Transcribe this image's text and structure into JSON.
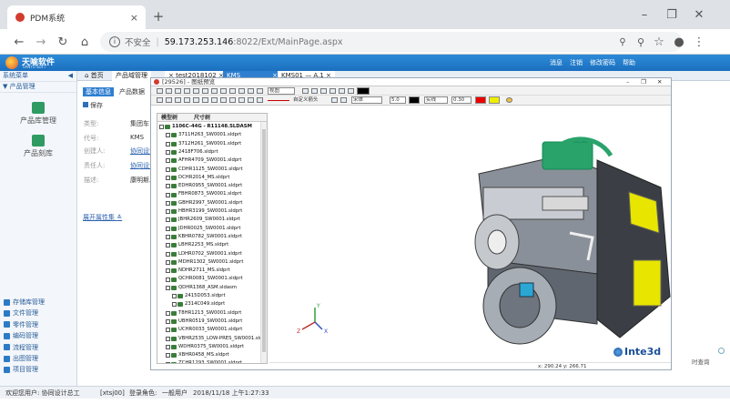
{
  "browser": {
    "tab_title": "PDM系统",
    "tab_close": "×",
    "new_tab": "+",
    "insecure_label": "不安全",
    "url_host": "59.173.253.146",
    "url_rest": ":8022/Ext/MainPage.aspx"
  },
  "app": {
    "logo_text": "天喻软件",
    "logo_sub": "TIANYU SOFT",
    "header_links": [
      "消息",
      "注销",
      "修改密码",
      "帮助"
    ]
  },
  "sidebar": {
    "menu_label": "系统菜单",
    "section_label": "产品管理",
    "tools": [
      "产品库管理",
      "产品刻库"
    ],
    "bottom_items": [
      "存储库管理",
      "文件管理",
      "零件管理",
      "编码管理",
      "流程管理",
      "出图管理",
      "项目管理"
    ]
  },
  "tabs": [
    {
      "label": "首页"
    },
    {
      "label": "产品域管理"
    },
    {
      "label": "test2018102"
    },
    {
      "label": "KMS"
    },
    {
      "label": "KMS01 — A.1"
    }
  ],
  "form": {
    "tab_basic": "基本信息",
    "tab_product": "产品数据",
    "save_label": "保存",
    "rows": [
      {
        "label": "类型:",
        "value": "集团车"
      },
      {
        "label": "代号:",
        "value": "KMS"
      },
      {
        "label": "创建人:",
        "value": "协同设计"
      },
      {
        "label": "责任人:",
        "value": "协同设计"
      },
      {
        "label": "描述:",
        "value": "康明斯发"
      }
    ],
    "expand_link": "展开属性集"
  },
  "viewer": {
    "title": "[29526] - 图纸预览",
    "toolbar_view_select": "视图",
    "toolbar_define_label": "自定义箭头",
    "toolbar_font_select": "宋体",
    "toolbar_size_select": "5.0",
    "toolbar_line_select": "实线",
    "toolbar_width_select": "0.30",
    "tree_col1": "模型树",
    "tree_col2": "尺寸树",
    "tree_root": "1106C-44G - R11148.SLDASM",
    "tree_items": [
      {
        "name": "3711H263_SW0001.sldprt",
        "indent": 1
      },
      {
        "name": "3712H261_SW0001.sldprt",
        "indent": 1
      },
      {
        "name": "2418F706.sldprt",
        "indent": 1
      },
      {
        "name": "AFHR4709_SW0001.sldprt",
        "indent": 1
      },
      {
        "name": "CDHR1125_SW0001.sldprt",
        "indent": 1
      },
      {
        "name": "DCHR2014_MS.sldprt",
        "indent": 1
      },
      {
        "name": "EDHR0955_SW0001.sldprt",
        "indent": 1
      },
      {
        "name": "FBHR0873_SW0001.sldprt",
        "indent": 1
      },
      {
        "name": "GBHR2997_SW0001.sldprt",
        "indent": 1
      },
      {
        "name": "HBHR3199_SW0001.sldprt",
        "indent": 1
      },
      {
        "name": "JBHR2609_SW0001.sldprt",
        "indent": 1
      },
      {
        "name": "JDHR0025_SW0001.sldprt",
        "indent": 1
      },
      {
        "name": "KBHR0782_SW0001.sldprt",
        "indent": 1
      },
      {
        "name": "LBHR2253_MS.sldprt",
        "indent": 1
      },
      {
        "name": "LDHR0702_SW0001.sldprt",
        "indent": 1
      },
      {
        "name": "MDHR1302_SW0001.sldprt",
        "indent": 1
      },
      {
        "name": "NDHR2711_MS.sldprt",
        "indent": 1
      },
      {
        "name": "QCHR0081_SW0001.sldprt",
        "indent": 1
      },
      {
        "name": "QDHR1368_ASM.sldasm",
        "indent": 1
      },
      {
        "name": "2415D053.sldprt",
        "indent": 2
      },
      {
        "name": "2314C049.sldprt",
        "indent": 2
      },
      {
        "name": "T8HR1213_SW0001.sldprt",
        "indent": 1
      },
      {
        "name": "UBHR0519_SW0001.sldprt",
        "indent": 1
      },
      {
        "name": "UCHR0033_SW0001.sldprt",
        "indent": 1
      },
      {
        "name": "VBHR2535_LOW-PRES_SW0001.sldp",
        "indent": 1
      },
      {
        "name": "WDHR0375_SW0001.sldprt",
        "indent": 1
      },
      {
        "name": "XBHR0458_MS.sldprt",
        "indent": 1
      },
      {
        "name": "ZCHR1293_SW0001.sldprt",
        "indent": 1
      },
      {
        "name": "ZJHR0565_ASM.sldasm",
        "indent": 1
      },
      {
        "name": "ZLHR0384_ASM.sldasm",
        "indent": 1
      },
      {
        "name": "ZMHR1372_SW0001.sldprt",
        "indent": 1
      }
    ],
    "brand": "Inte3d",
    "coords": "x: 290.24  y: 266.71",
    "side_text": "时查询"
  },
  "footer": {
    "welcome": "欢迎您用户: 协同设计总工",
    "user_code": "[xtsj00]",
    "role_prefix": "登录角色:",
    "role": "一般用户",
    "datetime": "2018/11/18 上午1:27:33"
  },
  "colors": {
    "header_blue": "#1f78c8",
    "active_tab": "#2f7fd0",
    "tool_green": "#2f9b62",
    "engine_yellow": "#e8e600"
  }
}
